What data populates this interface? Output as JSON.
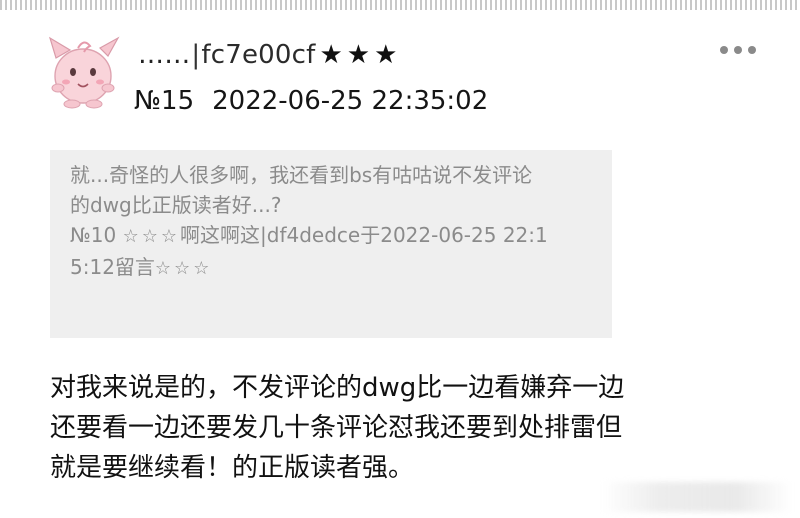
{
  "post": {
    "author_name": "……",
    "separator": "|",
    "user_id": "fc7e00cf",
    "author_stars": "★★★",
    "floor": "№15",
    "timestamp": "2022-06-25 22:35:02",
    "more_icon": "more-horizontal-icon"
  },
  "quote": {
    "line1": "就...奇怪的人很多啊，我还看到bs有咕咕说不发评论",
    "line2": "的dwg比正版读者好...?",
    "line3_floor": "№10 ",
    "line3_stars_a": "☆☆☆",
    "line3_rest": "啊这啊这|df4dedce于2022-06-25 22:1",
    "line4": "5:12留言",
    "line4_stars": "☆☆☆"
  },
  "reply": {
    "line1": "对我来说是的，不发评论的dwg比一边看嫌弃一边",
    "line2": "还要看一边还要发几十条评论怼我还要到处排雷但",
    "line3": "就是要继续看！的正版读者强。"
  },
  "colors": {
    "quote_background": "#efefef",
    "quote_text": "#8b8b8b",
    "body_text": "#111111",
    "menu_dots": "#8a8a8a"
  }
}
